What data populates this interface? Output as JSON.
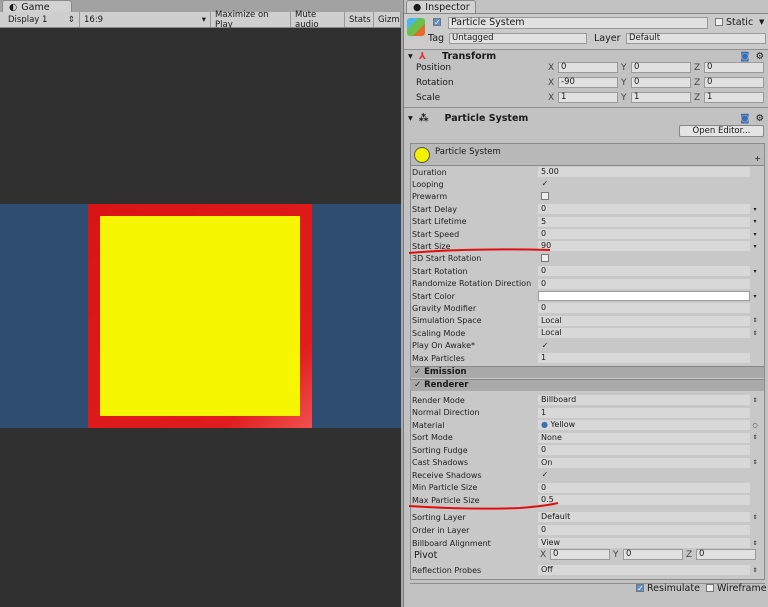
{
  "game": {
    "tab": "Game",
    "display": "Display 1",
    "aspect": "16:9",
    "maximize": "Maximize on Play",
    "mute": "Mute audio",
    "stats": "Stats",
    "gizmos": "Gizmos"
  },
  "inspector": {
    "tab": "Inspector",
    "object_name": "Particle System",
    "static_label": "Static",
    "tag_label": "Tag",
    "tag": "Untagged",
    "layer_label": "Layer",
    "layer": "Default",
    "transform": {
      "title": "Transform",
      "rows": [
        {
          "label": "Position",
          "x": "0",
          "y": "0",
          "z": "0"
        },
        {
          "label": "Rotation",
          "x": "-90",
          "y": "0",
          "z": "0"
        },
        {
          "label": "Scale",
          "x": "1",
          "y": "1",
          "z": "1"
        }
      ]
    },
    "particle_component": {
      "title": "Particle System",
      "open_editor": "Open Editor...",
      "module_title": "Particle System"
    },
    "main_rows": [
      {
        "label": "Duration",
        "value": "5.00",
        "type": "text"
      },
      {
        "label": "Looping",
        "value": "✓",
        "type": "check"
      },
      {
        "label": "Prewarm",
        "value": "",
        "type": "check"
      },
      {
        "label": "Start Delay",
        "value": "0",
        "type": "curve"
      },
      {
        "label": "Start Lifetime",
        "value": "5",
        "type": "curve"
      },
      {
        "label": "Start Speed",
        "value": "0",
        "type": "curve"
      },
      {
        "label": "Start Size",
        "value": "90",
        "type": "curve"
      },
      {
        "label": "3D Start Rotation",
        "value": "",
        "type": "check"
      },
      {
        "label": "Start Rotation",
        "value": "0",
        "type": "curve"
      },
      {
        "label": "Randomize Rotation Direction",
        "value": "0",
        "type": "text"
      },
      {
        "label": "Start Color",
        "value": "",
        "type": "color"
      },
      {
        "label": "Gravity Modifier",
        "value": "0",
        "type": "text"
      },
      {
        "label": "Simulation Space",
        "value": "Local",
        "type": "dropdown"
      },
      {
        "label": "Scaling Mode",
        "value": "Local",
        "type": "dropdown"
      },
      {
        "label": "Play On Awake*",
        "value": "✓",
        "type": "check"
      },
      {
        "label": "Max Particles",
        "value": "1",
        "type": "text"
      }
    ],
    "emission": "Emission",
    "renderer": "Renderer",
    "renderer_rows": [
      {
        "label": "Render Mode",
        "value": "Billboard",
        "type": "dropdown"
      },
      {
        "label": "Normal Direction",
        "value": "1",
        "type": "text"
      },
      {
        "label": "Material",
        "value": "Yellow",
        "type": "object"
      },
      {
        "label": "Sort Mode",
        "value": "None",
        "type": "dropdown"
      },
      {
        "label": "Sorting Fudge",
        "value": "0",
        "type": "text"
      },
      {
        "label": "Cast Shadows",
        "value": "On",
        "type": "dropdown"
      },
      {
        "label": "Receive Shadows",
        "value": "✓",
        "type": "check"
      },
      {
        "label": "Min Particle Size",
        "value": "0",
        "type": "text"
      },
      {
        "label": "Max Particle Size",
        "value": "0.5",
        "type": "text"
      }
    ],
    "renderer_rows2": [
      {
        "label": "Sorting Layer",
        "value": "Default",
        "type": "dropdown"
      },
      {
        "label": "Order in Layer",
        "value": "0",
        "type": "text"
      },
      {
        "label": "Billboard Alignment",
        "value": "View",
        "type": "dropdown"
      }
    ],
    "pivot": {
      "label": "Pivot",
      "x": "0",
      "y": "0",
      "z": "0"
    },
    "reflection": {
      "label": "Reflection Probes",
      "value": "Off"
    },
    "resimulate": "Resimulate",
    "wireframe": "Wireframe"
  },
  "colors": {
    "accent_underline": "#e01010",
    "sky": "#2e4b70",
    "particle_border": "#d91414",
    "particle_fill": "#f6f600"
  }
}
